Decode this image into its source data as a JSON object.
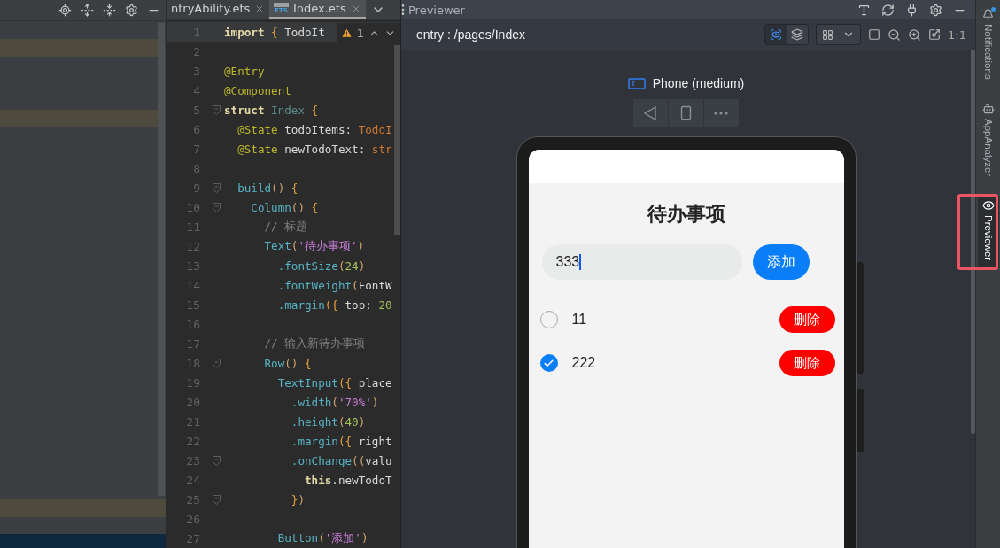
{
  "editor_tabs": [
    {
      "label": "ntryAbility.ets",
      "selected": false
    },
    {
      "label": "Index.ets",
      "selected": true,
      "icon_label": "ETS"
    }
  ],
  "editor": {
    "warning_count": "1",
    "lines": [
      {
        "number": "1",
        "fold": false,
        "current": true,
        "tokens": [
          {
            "text": "import",
            "kind": "keyword"
          },
          {
            "text": " {",
            "kind": "brace"
          },
          {
            "text": " TodoIt",
            "kind": "field"
          }
        ]
      },
      {
        "number": "2",
        "fold": false,
        "current": false
      },
      {
        "number": "3",
        "fold": false,
        "current": false,
        "tokens": [
          {
            "text": "@Entry",
            "kind": "annotation"
          }
        ]
      },
      {
        "number": "4",
        "fold": false,
        "current": false,
        "tokens": [
          {
            "text": "@Component",
            "kind": "annotation"
          }
        ]
      },
      {
        "number": "5",
        "fold": true,
        "current": false,
        "tokens": [
          {
            "text": "struct",
            "kind": "keyword"
          },
          {
            "text": " Index",
            "kind": "typename"
          },
          {
            "text": " {",
            "kind": "brace"
          }
        ]
      },
      {
        "number": "6",
        "fold": false,
        "current": false,
        "tokens": [
          {
            "text": "  @State",
            "kind": "annotation"
          },
          {
            "text": " todoItems: ",
            "kind": "field"
          },
          {
            "text": "TodoI",
            "kind": "typeref"
          }
        ]
      },
      {
        "number": "7",
        "fold": false,
        "current": false,
        "tokens": [
          {
            "text": "  @State",
            "kind": "annotation"
          },
          {
            "text": " newTodoText: ",
            "kind": "field"
          },
          {
            "text": "str",
            "kind": "typeref"
          }
        ]
      },
      {
        "number": "8",
        "fold": false,
        "current": false
      },
      {
        "number": "9",
        "fold": true,
        "current": false,
        "tokens": [
          {
            "text": "  build",
            "kind": "function"
          },
          {
            "text": "()",
            "kind": "paren"
          },
          {
            "text": " {",
            "kind": "brace"
          }
        ]
      },
      {
        "number": "10",
        "fold": true,
        "current": false,
        "tokens": [
          {
            "text": "    Column",
            "kind": "function"
          },
          {
            "text": "()",
            "kind": "paren"
          },
          {
            "text": " {",
            "kind": "brace"
          }
        ]
      },
      {
        "number": "11",
        "fold": false,
        "current": false,
        "tokens": [
          {
            "text": "      // 标题",
            "kind": "comment"
          }
        ]
      },
      {
        "number": "12",
        "fold": false,
        "current": false,
        "tokens": [
          {
            "text": "      Text",
            "kind": "function"
          },
          {
            "text": "(",
            "kind": "paren"
          },
          {
            "text": "'待办事项'",
            "kind": "string"
          },
          {
            "text": ")",
            "kind": "paren"
          }
        ]
      },
      {
        "number": "13",
        "fold": false,
        "current": false,
        "tokens": [
          {
            "text": "        .fontSize",
            "kind": "function"
          },
          {
            "text": "(",
            "kind": "paren"
          },
          {
            "text": "24",
            "kind": "number"
          },
          {
            "text": ")",
            "kind": "paren"
          }
        ]
      },
      {
        "number": "14",
        "fold": false,
        "current": false,
        "tokens": [
          {
            "text": "        .fontWeight",
            "kind": "function"
          },
          {
            "text": "(",
            "kind": "paren"
          },
          {
            "text": "FontW",
            "kind": "field"
          }
        ]
      },
      {
        "number": "15",
        "fold": false,
        "current": false,
        "tokens": [
          {
            "text": "        .margin",
            "kind": "function"
          },
          {
            "text": "({",
            "kind": "brace"
          },
          {
            "text": " top: ",
            "kind": "field"
          },
          {
            "text": "20",
            "kind": "number"
          }
        ]
      },
      {
        "number": "16",
        "fold": false,
        "current": false
      },
      {
        "number": "17",
        "fold": false,
        "current": false,
        "tokens": [
          {
            "text": "      // 输入新待办事项",
            "kind": "comment"
          }
        ]
      },
      {
        "number": "18",
        "fold": true,
        "current": false,
        "tokens": [
          {
            "text": "      Row",
            "kind": "function"
          },
          {
            "text": "()",
            "kind": "paren"
          },
          {
            "text": " {",
            "kind": "brace"
          }
        ]
      },
      {
        "number": "19",
        "fold": false,
        "current": false,
        "tokens": [
          {
            "text": "        TextInput",
            "kind": "function"
          },
          {
            "text": "({",
            "kind": "brace"
          },
          {
            "text": " place",
            "kind": "field"
          }
        ]
      },
      {
        "number": "20",
        "fold": false,
        "current": false,
        "tokens": [
          {
            "text": "          .width",
            "kind": "function"
          },
          {
            "text": "(",
            "kind": "paren"
          },
          {
            "text": "'70%'",
            "kind": "string"
          },
          {
            "text": ")",
            "kind": "paren"
          }
        ]
      },
      {
        "number": "21",
        "fold": false,
        "current": false,
        "tokens": [
          {
            "text": "          .height",
            "kind": "function"
          },
          {
            "text": "(",
            "kind": "paren"
          },
          {
            "text": "40",
            "kind": "number"
          },
          {
            "text": ")",
            "kind": "paren"
          }
        ]
      },
      {
        "number": "22",
        "fold": false,
        "current": false,
        "tokens": [
          {
            "text": "          .margin",
            "kind": "function"
          },
          {
            "text": "({",
            "kind": "brace"
          },
          {
            "text": " right",
            "kind": "field"
          }
        ]
      },
      {
        "number": "23",
        "fold": true,
        "current": false,
        "tokens": [
          {
            "text": "          .onChange",
            "kind": "function"
          },
          {
            "text": "((",
            "kind": "paren"
          },
          {
            "text": "valu",
            "kind": "field"
          }
        ]
      },
      {
        "number": "24",
        "fold": false,
        "current": false,
        "tokens": [
          {
            "text": "            this",
            "kind": "keyword"
          },
          {
            "text": ".newTodoT",
            "kind": "field"
          }
        ]
      },
      {
        "number": "25",
        "fold": true,
        "current": false,
        "tokens": [
          {
            "text": "          }",
            "kind": "brace"
          },
          {
            "text": ")",
            "kind": "paren"
          }
        ]
      },
      {
        "number": "26",
        "fold": false,
        "current": false
      },
      {
        "number": "27",
        "fold": false,
        "current": false,
        "tokens": [
          {
            "text": "        Button",
            "kind": "function"
          },
          {
            "text": "(",
            "kind": "paren"
          },
          {
            "text": "'添加'",
            "kind": "string"
          },
          {
            "text": ")",
            "kind": "paren"
          }
        ]
      }
    ]
  },
  "previewer": {
    "title": "Previewer",
    "route": "entry : /pages/Index",
    "zoom_label": "1:1",
    "view_modes": [
      {
        "kind": "inspect",
        "selected": true
      },
      {
        "kind": "layers",
        "selected": false
      }
    ],
    "device": "Phone (medium)"
  },
  "app": {
    "title": "待办事项",
    "input_value": "333",
    "add_button": "添加",
    "todos": [
      {
        "text": "11",
        "checked": false,
        "delete_label": "删除"
      },
      {
        "text": "222",
        "checked": true,
        "delete_label": "删除"
      }
    ]
  },
  "side_tabs": [
    {
      "label": "Notifications",
      "kind": "bell",
      "selected": false
    },
    {
      "label": "AppAnalyzer",
      "kind": "analyzer",
      "selected": false
    },
    {
      "label": "Previewer",
      "kind": "eye",
      "selected": true
    }
  ]
}
